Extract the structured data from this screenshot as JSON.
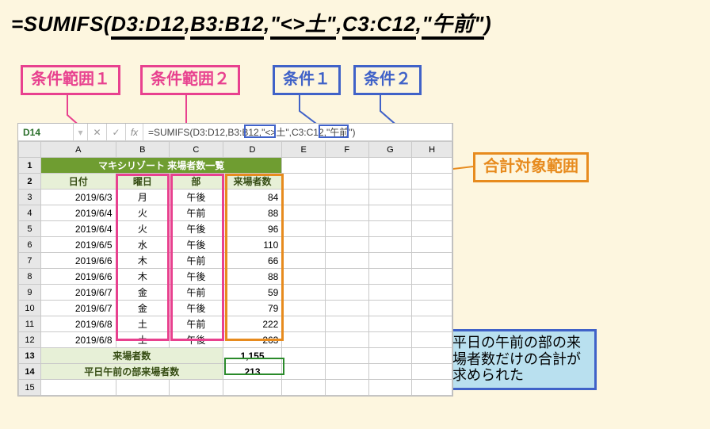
{
  "formula": {
    "lead": "=SUMIFS(",
    "arg1": "D3:D12",
    "arg2": "B3:B12",
    "arg3": "\"<>土\"",
    "arg4": "C3:C12",
    "arg5": "\"午前\"",
    "tail": ")"
  },
  "labels": {
    "range1": "条件範囲１",
    "range2": "条件範囲２",
    "cond1": "条件１",
    "cond2": "条件２",
    "sum_range": "合計対象範囲",
    "result_note": "平日の午前の部の来場者数だけの合計が求められた"
  },
  "excel": {
    "name_box": "D14",
    "fx_label": "fx",
    "formula_bar": {
      "lead": "=SUMIFS(D3:D12,B3:B12,",
      "hl1": "\"<>土\"",
      "mid": ",C3:C12,",
      "hl2": "\"午前\"",
      "tail": ")"
    },
    "columns": [
      "",
      "A",
      "B",
      "C",
      "D",
      "E",
      "F",
      "G",
      "H"
    ],
    "row_headers": [
      "1",
      "2",
      "3",
      "4",
      "5",
      "6",
      "7",
      "8",
      "9",
      "10",
      "11",
      "12",
      "13",
      "14",
      "15"
    ],
    "title": "マキシリゾート 来場者数一覧",
    "headers": {
      "a": "日付",
      "b": "曜日",
      "c": "部",
      "d": "来場者数"
    },
    "rows": [
      {
        "a": "2019/6/3",
        "b": "月",
        "c": "午後",
        "d": "84"
      },
      {
        "a": "2019/6/4",
        "b": "火",
        "c": "午前",
        "d": "88"
      },
      {
        "a": "2019/6/4",
        "b": "火",
        "c": "午後",
        "d": "96"
      },
      {
        "a": "2019/6/5",
        "b": "水",
        "c": "午後",
        "d": "110"
      },
      {
        "a": "2019/6/6",
        "b": "木",
        "c": "午前",
        "d": "66"
      },
      {
        "a": "2019/6/6",
        "b": "木",
        "c": "午後",
        "d": "88"
      },
      {
        "a": "2019/6/7",
        "b": "金",
        "c": "午前",
        "d": "59"
      },
      {
        "a": "2019/6/7",
        "b": "金",
        "c": "午後",
        "d": "79"
      },
      {
        "a": "2019/6/8",
        "b": "土",
        "c": "午前",
        "d": "222"
      },
      {
        "a": "2019/6/8",
        "b": "土",
        "c": "午後",
        "d": "263"
      }
    ],
    "totals": {
      "row13_label": "来場者数",
      "row13_value": "1,155",
      "row14_label": "平日午前の部来場者数",
      "row14_value": "213"
    }
  }
}
